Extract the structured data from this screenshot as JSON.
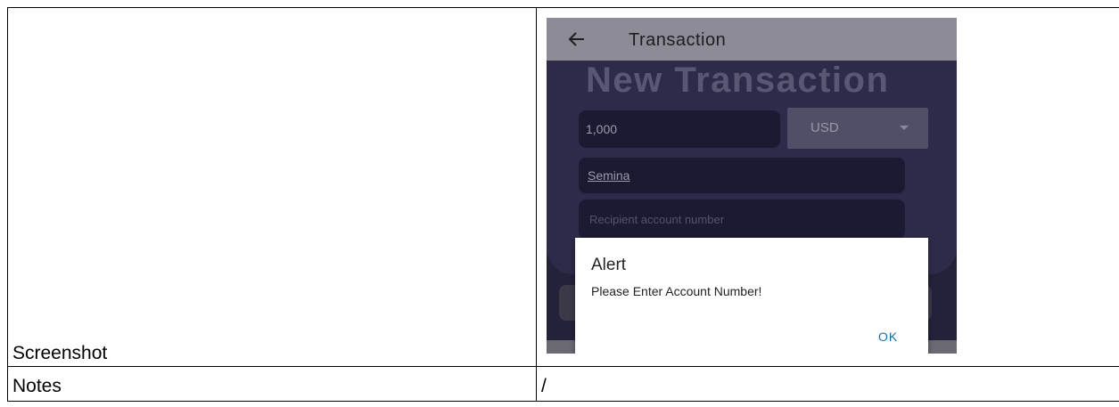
{
  "table": {
    "rows": [
      {
        "label": "Screenshot"
      },
      {
        "label": "Notes",
        "value": "/"
      }
    ]
  },
  "phone": {
    "appbar": {
      "title": "Transaction",
      "back_icon": "arrow-left-icon"
    },
    "heading": "New Transaction",
    "amount_value": "1,000",
    "currency_value": "USD",
    "recipient_name_value": "Semina",
    "account_placeholder": "Recipient account number",
    "dialog": {
      "title": "Alert",
      "message": "Please Enter Account Number!",
      "ok_label": "OK"
    }
  }
}
